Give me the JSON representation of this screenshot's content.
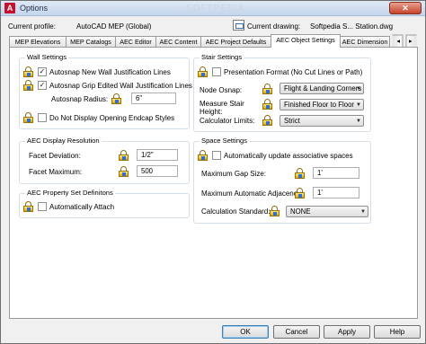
{
  "window": {
    "title": "Options",
    "app_icon_letter": "A",
    "close_symbol": "✕",
    "watermark": "SOFTPEDIA"
  },
  "profile": {
    "current_profile_label": "Current profile:",
    "current_profile_value": "AutoCAD MEP (Global)",
    "current_drawing_label": "Current drawing:",
    "current_drawing_value": "Softpedia S... Station.dwg"
  },
  "tabs": [
    {
      "label": "MEP Elevations"
    },
    {
      "label": "MEP Catalogs"
    },
    {
      "label": "AEC Editor"
    },
    {
      "label": "AEC Content"
    },
    {
      "label": "AEC Project Defaults"
    },
    {
      "label": "AEC Object Settings"
    },
    {
      "label": "AEC Dimension"
    }
  ],
  "active_tab": "AEC Object Settings",
  "wall_settings": {
    "title": "Wall Settings",
    "autosnap_new": {
      "label": "Autosnap New Wall Justification Lines",
      "checked": true
    },
    "autosnap_grip": {
      "label": "Autosnap Grip Edited Wall Justification Lines",
      "checked": true
    },
    "autosnap_radius_label": "Autosnap Radius:",
    "autosnap_radius_value": "6\"",
    "no_endcap": {
      "label": "Do Not Display Opening Endcap Styles",
      "checked": false
    }
  },
  "aec_display_resolution": {
    "title": "AEC Display Resolution",
    "facet_deviation_label": "Facet Deviation:",
    "facet_deviation_value": "1/2\"",
    "facet_maximum_label": "Facet Maximum:",
    "facet_maximum_value": "500"
  },
  "aec_property_set": {
    "title": "AEC Property Set Definitons",
    "auto_attach": {
      "label": "Automatically Attach",
      "checked": false
    }
  },
  "stair_settings": {
    "title": "Stair Settings",
    "presentation_format": {
      "label": "Presentation Format (No Cut Lines or Path)",
      "checked": false
    },
    "node_osnap_label": "Node Osnap:",
    "node_osnap_value": "Flight & Landing Corners",
    "measure_height_label_1": "Measure Stair",
    "measure_height_label_2": "Height:",
    "measure_height_value": "Finished Floor to Floor",
    "calculator_limits_label": "Calculator Limits:",
    "calculator_limits_value": "Strict"
  },
  "space_settings": {
    "title": "Space Settings",
    "auto_update": {
      "label": "Automatically update associative spaces",
      "checked": false
    },
    "max_gap_label": "Maximum Gap Size:",
    "max_gap_value": "1'",
    "max_auto_adj_label": "Maximum Automatic Adjacency",
    "max_auto_adj_value": "1'",
    "calc_standard_label": "Calculation Standard:",
    "calc_standard_value": "NONE"
  },
  "buttons": {
    "ok": "OK",
    "cancel": "Cancel",
    "apply": "Apply",
    "help": "Help"
  },
  "icons": {
    "dropdown_arrow": "▼",
    "check_mark": "✓"
  }
}
